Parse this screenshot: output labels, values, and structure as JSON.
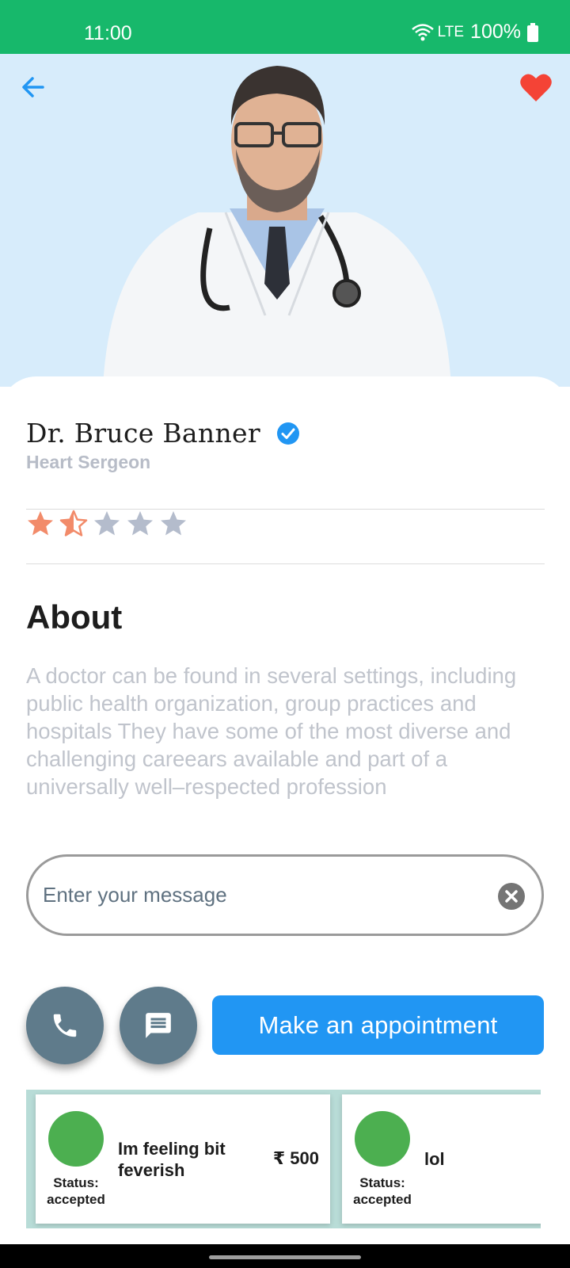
{
  "status_bar": {
    "time": "11:00",
    "network": "LTE",
    "battery": "100%"
  },
  "doctor": {
    "name": "Dr. Bruce Banner",
    "specialty": "Heart Sergeon",
    "rating": 1.5,
    "rating_max": 5
  },
  "about": {
    "title": "About",
    "text": "A doctor can be found in several settings, including public health organization, group practices and hospitals They have some of the most diverse and challenging careears available and part of a universally well–respected profession"
  },
  "message": {
    "placeholder": "Enter your message",
    "value": ""
  },
  "actions": {
    "appointment_label": "Make an appointment"
  },
  "appointments": [
    {
      "status": "Status: accepted",
      "description": "Im feeling bit feverish",
      "price": "₹ 500"
    },
    {
      "status": "Status: accepted",
      "description": "lol",
      "price": ""
    }
  ],
  "colors": {
    "status_bar": "#17b86b",
    "hero_bg": "#d7ecfb",
    "primary": "#2196f3",
    "round_button": "#5f7b8b",
    "star_filled": "#f28b6a",
    "star_empty": "#b4bccc",
    "heart": "#f44336",
    "avatar": "#4caf50"
  },
  "icons": {
    "back": "arrow-left-icon",
    "favorite": "heart-icon",
    "verified": "verified-check-icon",
    "clear": "clear-circle-icon",
    "call": "phone-icon",
    "chat": "chat-icon"
  }
}
